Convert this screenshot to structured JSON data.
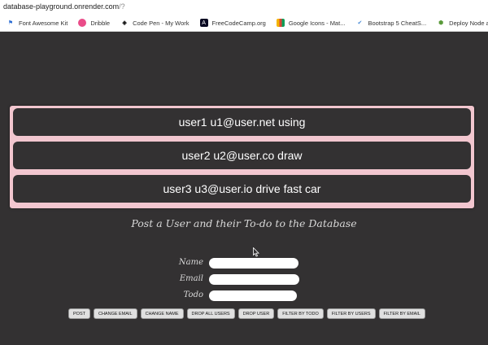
{
  "browser": {
    "url_host": "database-playground.onrender.com",
    "url_path": "/?",
    "bookmarks": [
      {
        "label": "Font Awesome Kit",
        "icon": "flag-icon",
        "glyph": "⚑"
      },
      {
        "label": "Dribble",
        "icon": "dribbble-icon",
        "glyph": "●"
      },
      {
        "label": "Code Pen - My Work",
        "icon": "codepen-icon",
        "glyph": "◈"
      },
      {
        "label": "FreeCodeCamp.org",
        "icon": "freecodecamp-icon",
        "glyph": "A"
      },
      {
        "label": "Google Icons - Mat...",
        "icon": "google-icons-icon",
        "glyph": ""
      },
      {
        "label": "Bootstrap 5 CheatS...",
        "icon": "bootstrap-check-icon",
        "glyph": "✔"
      },
      {
        "label": "Deploy Node app",
        "icon": "node-deploy-icon",
        "glyph": "⬢"
      }
    ]
  },
  "users": [
    {
      "text": "user1 u1@user.net using"
    },
    {
      "text": "user2 u2@user.co draw"
    },
    {
      "text": "user3 u3@user.io drive fast car"
    }
  ],
  "form": {
    "heading": "Post a User and their To-do to the Database",
    "name_label": "Name",
    "email_label": "Email",
    "todo_label": "Todo",
    "name_value": "",
    "email_value": "",
    "todo_value": ""
  },
  "buttons": {
    "post": "POST",
    "change_email": "CHANGE EMAIL",
    "change_name": "CHANGE NAME",
    "drop_all_users": "DROP ALL USERS",
    "drop_user": "DROP USER",
    "filter_by_todo": "FILTER BY TODO",
    "filter_by_users": "FILTER BY USERS",
    "filter_by_email": "FILTER BY EMAIL"
  },
  "colors": {
    "page_background": "#333132",
    "panel_pink": "#f2c6cf",
    "row_background": "#333132",
    "text_light": "#d8d8d8"
  }
}
